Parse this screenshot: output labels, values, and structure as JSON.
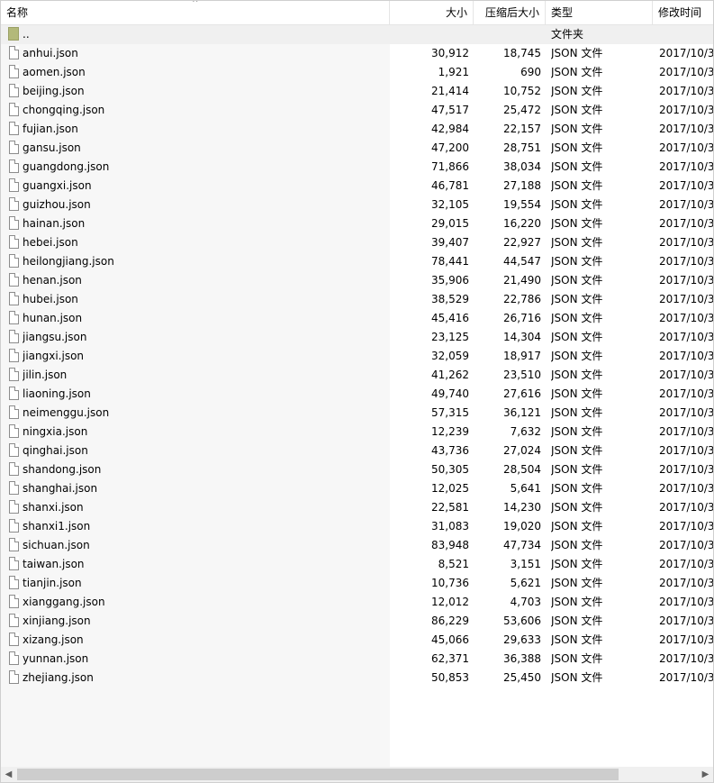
{
  "columns": {
    "name": "名称",
    "size": "大小",
    "packed": "压缩后大小",
    "type": "类型",
    "modified": "修改时间"
  },
  "parent_row": {
    "name": "..",
    "type": "文件夹",
    "icon": "folder-icon"
  },
  "files": [
    {
      "name": "anhui.json",
      "size": "30,912",
      "packed": "18,745",
      "type": "JSON 文件",
      "modified": "2017/10/3"
    },
    {
      "name": "aomen.json",
      "size": "1,921",
      "packed": "690",
      "type": "JSON 文件",
      "modified": "2017/10/3"
    },
    {
      "name": "beijing.json",
      "size": "21,414",
      "packed": "10,752",
      "type": "JSON 文件",
      "modified": "2017/10/3"
    },
    {
      "name": "chongqing.json",
      "size": "47,517",
      "packed": "25,472",
      "type": "JSON 文件",
      "modified": "2017/10/3"
    },
    {
      "name": "fujian.json",
      "size": "42,984",
      "packed": "22,157",
      "type": "JSON 文件",
      "modified": "2017/10/3"
    },
    {
      "name": "gansu.json",
      "size": "47,200",
      "packed": "28,751",
      "type": "JSON 文件",
      "modified": "2017/10/3"
    },
    {
      "name": "guangdong.json",
      "size": "71,866",
      "packed": "38,034",
      "type": "JSON 文件",
      "modified": "2017/10/3"
    },
    {
      "name": "guangxi.json",
      "size": "46,781",
      "packed": "27,188",
      "type": "JSON 文件",
      "modified": "2017/10/3"
    },
    {
      "name": "guizhou.json",
      "size": "32,105",
      "packed": "19,554",
      "type": "JSON 文件",
      "modified": "2017/10/3"
    },
    {
      "name": "hainan.json",
      "size": "29,015",
      "packed": "16,220",
      "type": "JSON 文件",
      "modified": "2017/10/3"
    },
    {
      "name": "hebei.json",
      "size": "39,407",
      "packed": "22,927",
      "type": "JSON 文件",
      "modified": "2017/10/3"
    },
    {
      "name": "heilongjiang.json",
      "size": "78,441",
      "packed": "44,547",
      "type": "JSON 文件",
      "modified": "2017/10/3"
    },
    {
      "name": "henan.json",
      "size": "35,906",
      "packed": "21,490",
      "type": "JSON 文件",
      "modified": "2017/10/3"
    },
    {
      "name": "hubei.json",
      "size": "38,529",
      "packed": "22,786",
      "type": "JSON 文件",
      "modified": "2017/10/3"
    },
    {
      "name": "hunan.json",
      "size": "45,416",
      "packed": "26,716",
      "type": "JSON 文件",
      "modified": "2017/10/3"
    },
    {
      "name": "jiangsu.json",
      "size": "23,125",
      "packed": "14,304",
      "type": "JSON 文件",
      "modified": "2017/10/3"
    },
    {
      "name": "jiangxi.json",
      "size": "32,059",
      "packed": "18,917",
      "type": "JSON 文件",
      "modified": "2017/10/3"
    },
    {
      "name": "jilin.json",
      "size": "41,262",
      "packed": "23,510",
      "type": "JSON 文件",
      "modified": "2017/10/3"
    },
    {
      "name": "liaoning.json",
      "size": "49,740",
      "packed": "27,616",
      "type": "JSON 文件",
      "modified": "2017/10/3"
    },
    {
      "name": "neimenggu.json",
      "size": "57,315",
      "packed": "36,121",
      "type": "JSON 文件",
      "modified": "2017/10/3"
    },
    {
      "name": "ningxia.json",
      "size": "12,239",
      "packed": "7,632",
      "type": "JSON 文件",
      "modified": "2017/10/3"
    },
    {
      "name": "qinghai.json",
      "size": "43,736",
      "packed": "27,024",
      "type": "JSON 文件",
      "modified": "2017/10/3"
    },
    {
      "name": "shandong.json",
      "size": "50,305",
      "packed": "28,504",
      "type": "JSON 文件",
      "modified": "2017/10/3"
    },
    {
      "name": "shanghai.json",
      "size": "12,025",
      "packed": "5,641",
      "type": "JSON 文件",
      "modified": "2017/10/3"
    },
    {
      "name": "shanxi.json",
      "size": "22,581",
      "packed": "14,230",
      "type": "JSON 文件",
      "modified": "2017/10/3"
    },
    {
      "name": "shanxi1.json",
      "size": "31,083",
      "packed": "19,020",
      "type": "JSON 文件",
      "modified": "2017/10/3"
    },
    {
      "name": "sichuan.json",
      "size": "83,948",
      "packed": "47,734",
      "type": "JSON 文件",
      "modified": "2017/10/3"
    },
    {
      "name": "taiwan.json",
      "size": "8,521",
      "packed": "3,151",
      "type": "JSON 文件",
      "modified": "2017/10/3"
    },
    {
      "name": "tianjin.json",
      "size": "10,736",
      "packed": "5,621",
      "type": "JSON 文件",
      "modified": "2017/10/3"
    },
    {
      "name": "xianggang.json",
      "size": "12,012",
      "packed": "4,703",
      "type": "JSON 文件",
      "modified": "2017/10/3"
    },
    {
      "name": "xinjiang.json",
      "size": "86,229",
      "packed": "53,606",
      "type": "JSON 文件",
      "modified": "2017/10/3"
    },
    {
      "name": "xizang.json",
      "size": "45,066",
      "packed": "29,633",
      "type": "JSON 文件",
      "modified": "2017/10/3"
    },
    {
      "name": "yunnan.json",
      "size": "62,371",
      "packed": "36,388",
      "type": "JSON 文件",
      "modified": "2017/10/3"
    },
    {
      "name": "zhejiang.json",
      "size": "50,853",
      "packed": "25,450",
      "type": "JSON 文件",
      "modified": "2017/10/3"
    }
  ],
  "icons": {
    "sort": "sort-ascending-icon",
    "file": "file-icon",
    "folder": "folder-icon",
    "scroll_left": "scroll-left-arrow-icon",
    "scroll_right": "scroll-right-arrow-icon"
  },
  "colors": {
    "name_column_background": "#f7f7f7",
    "parent_row_background": "#f0f0f0",
    "folder_icon": "#b3b97a",
    "grid_line": "#e5e5e5",
    "scrollbar_track": "#f0f0f0",
    "scrollbar_thumb": "#cdcdcd"
  }
}
